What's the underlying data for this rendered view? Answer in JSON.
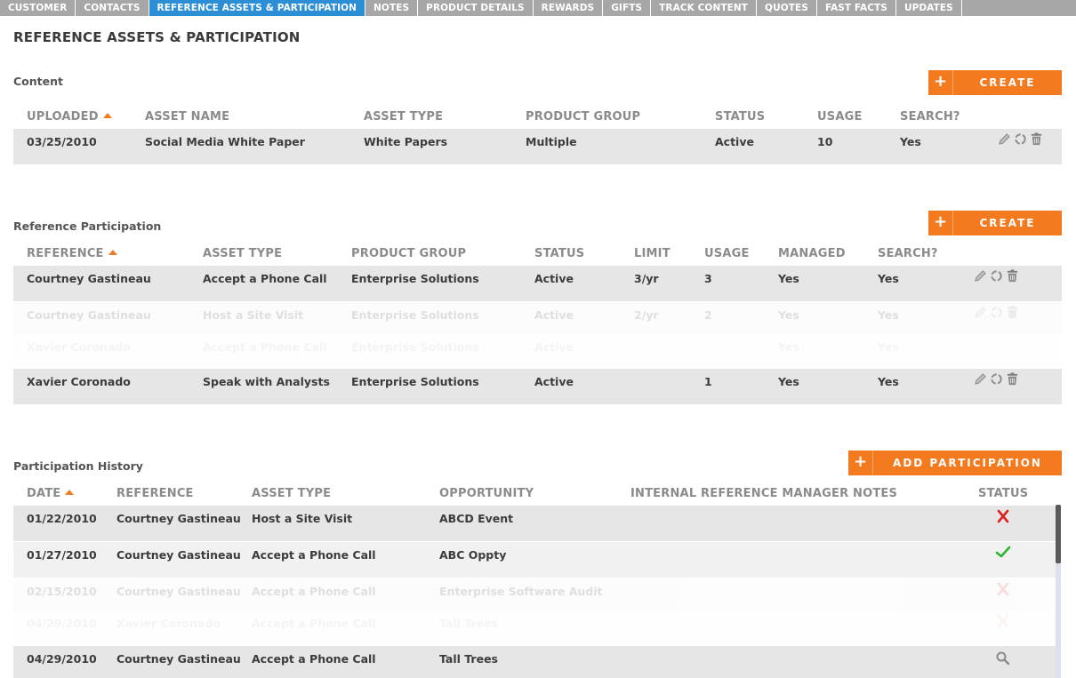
{
  "nav": {
    "tabs": [
      {
        "label": "CUSTOMER"
      },
      {
        "label": "CONTACTS"
      },
      {
        "label": "REFERENCE ASSETS & PARTICIPATION",
        "active": true
      },
      {
        "label": "NOTES"
      },
      {
        "label": "PRODUCT DETAILS"
      },
      {
        "label": "REWARDS"
      },
      {
        "label": "GIFTS"
      },
      {
        "label": "TRACK CONTENT"
      },
      {
        "label": "QUOTES"
      },
      {
        "label": "FAST FACTS"
      },
      {
        "label": "UPDATES"
      }
    ]
  },
  "page": {
    "title": "REFERENCE ASSETS & PARTICIPATION"
  },
  "colors": {
    "accent": "#f47a20",
    "active_tab": "#2c8fd6",
    "nav_bg": "#a7a7a7",
    "fail": "#e02020",
    "success": "#2db52d"
  },
  "content": {
    "title": "Content",
    "create_label": "CREATE",
    "headers": [
      "UPLOADED",
      "ASSET NAME",
      "ASSET TYPE",
      "PRODUCT GROUP",
      "STATUS",
      "USAGE",
      "SEARCH?"
    ],
    "rows": [
      {
        "uploaded": "03/25/2010",
        "asset_name": "Social Media White Paper",
        "asset_type": "White Papers",
        "product_group": "Multiple",
        "status": "Active",
        "usage": "10",
        "search": "Yes"
      }
    ]
  },
  "participation": {
    "title": "Reference Participation",
    "create_label": "CREATE",
    "headers": [
      "REFERENCE",
      "ASSET TYPE",
      "PRODUCT GROUP",
      "STATUS",
      "LIMIT",
      "USAGE",
      "MANAGED",
      "SEARCH?"
    ],
    "rows": [
      {
        "reference": "Courtney Gastineau",
        "asset_type": "Accept a Phone Call",
        "product_group": "Enterprise Solutions",
        "status": "Active",
        "limit": "3/yr",
        "usage": "3",
        "managed": "Yes",
        "search": "Yes"
      },
      {
        "reference": "Courtney Gastineau",
        "asset_type": "Host a Site Visit",
        "product_group": "Enterprise Solutions",
        "status": "Active",
        "limit": "2/yr",
        "usage": "2",
        "managed": "Yes",
        "search": "Yes"
      },
      {
        "reference": "Xavier Coronado",
        "asset_type": "Accept a Phone Call",
        "product_group": "Enterprise Solutions",
        "status": "Active",
        "limit": "",
        "usage": "",
        "managed": "Yes",
        "search": "Yes"
      },
      {
        "reference": "Xavier Coronado",
        "asset_type": "Speak with Analysts",
        "product_group": "Enterprise Solutions",
        "status": "Active",
        "limit": "",
        "usage": "1",
        "managed": "Yes",
        "search": "Yes"
      }
    ]
  },
  "history": {
    "title": "Participation History",
    "add_label": "ADD PARTICIPATION",
    "headers": [
      "DATE",
      "REFERENCE",
      "ASSET TYPE",
      "OPPORTUNITY",
      "INTERNAL REFERENCE MANAGER NOTES",
      "STATUS"
    ],
    "rows": [
      {
        "date": "01/22/2010",
        "reference": "Courtney Gastineau",
        "asset_type": "Host a Site Visit",
        "opportunity": "ABCD Event",
        "notes": "",
        "status_icon": "x-icon"
      },
      {
        "date": "01/27/2010",
        "reference": "Courtney Gastineau",
        "asset_type": "Accept a Phone Call",
        "opportunity": "ABC Oppty",
        "notes": "",
        "status_icon": "check-icon"
      },
      {
        "date": "02/15/2010",
        "reference": "Courtney Gastineau",
        "asset_type": "Accept a Phone Call",
        "opportunity": "Enterprise Software Audit",
        "notes": "",
        "status_icon": "x-icon"
      },
      {
        "date": "04/29/2010",
        "reference": "Xavier Coronado",
        "asset_type": "Accept a Phone Call",
        "opportunity": "Tall Trees",
        "notes": "",
        "status_icon": "x-icon"
      },
      {
        "date": "04/29/2010",
        "reference": "Courtney Gastineau",
        "asset_type": "Accept a Phone Call",
        "opportunity": "Tall Trees",
        "notes": "",
        "status_icon": "search-icon"
      }
    ]
  }
}
